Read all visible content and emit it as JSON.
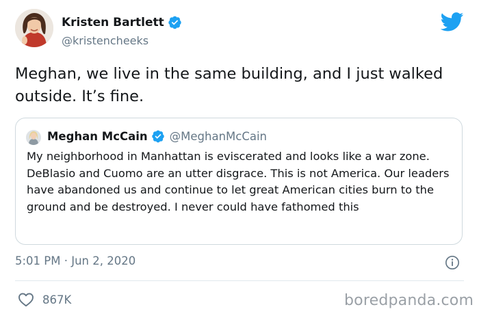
{
  "tweet": {
    "author": {
      "name": "Kristen Bartlett",
      "handle": "@kristencheeks",
      "verified": true
    },
    "text": "Meghan, we live in the same building, and I just walked outside. It’s fine.",
    "timestamp": "5:01 PM · Jun 2, 2020",
    "likes": "867K"
  },
  "quoted_tweet": {
    "author": {
      "name": "Meghan McCain",
      "handle": "@MeghanMcCain",
      "verified": true
    },
    "text": "My neighborhood in Manhattan is eviscerated and looks like a war zone. DeBlasio and Cuomo are an utter disgrace. This is not America. Our leaders have abandoned us and continue to let great American cities burn to the ground and be destroyed. I never could have fathomed this"
  },
  "watermark": "boredpanda.com",
  "icons": {
    "brand": "twitter-bird-icon",
    "verified": "verified-badge-icon",
    "info": "info-icon",
    "like": "heart-icon"
  },
  "colors": {
    "twitter_blue": "#1da1f2",
    "text_primary": "#14171a",
    "text_secondary": "#657786",
    "border": "#cfd9de"
  }
}
